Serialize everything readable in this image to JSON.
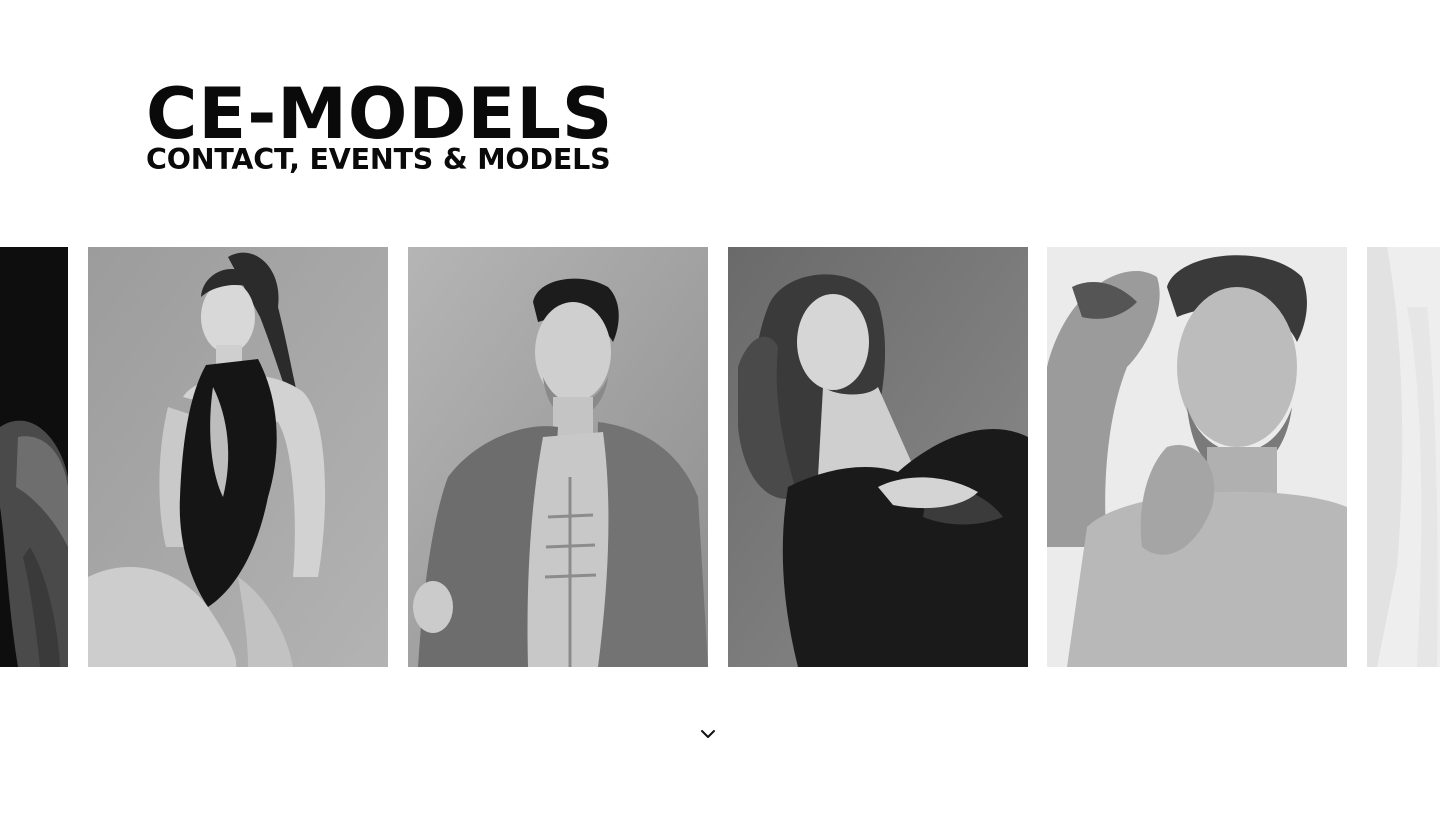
{
  "brand": {
    "title": "CE-MODELS",
    "subtitle": "CONTACT, EVENTS & MODELS"
  },
  "carousel": {
    "items": [
      {
        "icon": "model-photo",
        "tone": "#111111"
      },
      {
        "icon": "model-photo",
        "tone": "#9a9a9a"
      },
      {
        "icon": "model-photo",
        "tone": "#a8a8a8"
      },
      {
        "icon": "model-photo",
        "tone": "#7a7a7a"
      },
      {
        "icon": "model-photo",
        "tone": "#e6e6e6"
      },
      {
        "icon": "model-photo",
        "tone": "#ececec"
      }
    ]
  },
  "scroll_indicator": {
    "icon": "chevron-down-icon"
  }
}
